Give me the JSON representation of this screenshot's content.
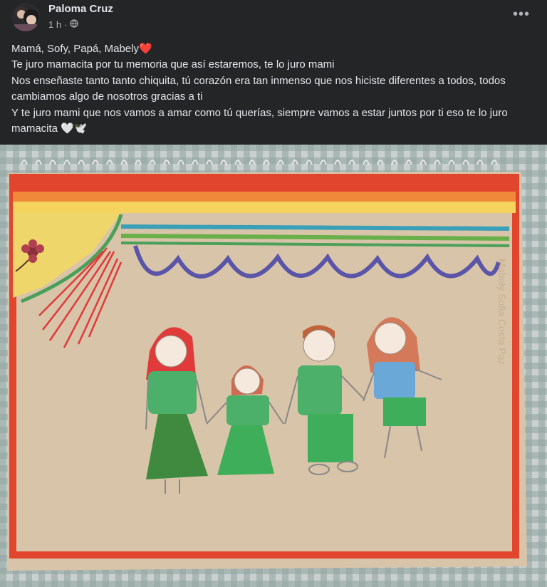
{
  "post": {
    "author": "Paloma Cruz",
    "time": "1 h",
    "time_separator": "·",
    "privacy_icon": "globe-icon",
    "more_label": "•••",
    "lines": [
      "Mamá, Sofy, Papá, Mabely❤️",
      "Te juro mamacita por tu memoria que así estaremos, te lo juro mami",
      "Nos enseñaste tanto tanto chiquita, tú corazón era tan inmenso que nos hiciste diferentes a todos, todos cambiamos algo de nosotros gracias a ti",
      "Y te juro mami que nos vamos a amar como tú querías, siempre vamos a estar juntos por ti eso te lo juro mamacita 🤍🕊️"
    ]
  },
  "colors": {
    "background": "#242526",
    "text_primary": "#e4e6eb",
    "text_secondary": "#b0b3b8"
  }
}
